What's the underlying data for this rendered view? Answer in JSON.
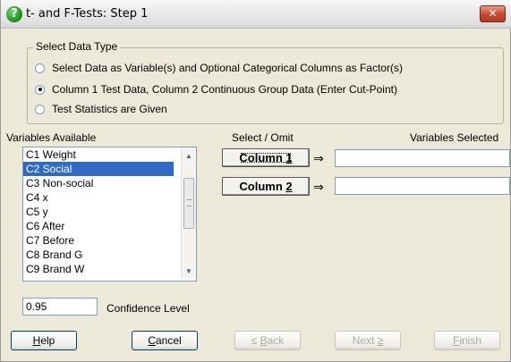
{
  "window": {
    "title": "t- and F-Tests: Step 1",
    "title_icon": "question-icon",
    "close_glyph": "✕"
  },
  "data_type": {
    "legend": "Select Data Type",
    "options": [
      {
        "label": "Select Data as Variable(s) and Optional Categorical Columns as Factor(s)",
        "checked": false
      },
      {
        "label": "Column 1 Test Data, Column 2 Continuous Group Data (Enter Cut-Point)",
        "checked": true
      },
      {
        "label": "Test Statistics are Given",
        "checked": false
      }
    ]
  },
  "variables": {
    "available_label": "Variables Available",
    "select_label": "Select / Omit",
    "selected_label": "Variables Selected",
    "items": [
      "C1 Weight",
      "C2 Social",
      "C3 Non-social",
      "C4 x",
      "C5 y",
      "C6 After",
      "C7 Before",
      "C8 Brand G",
      "C9 Brand W"
    ],
    "selected_item": "C2 Social"
  },
  "columns": {
    "column1_label": "Column 1",
    "column1_value": "",
    "column2_label": "Column 2",
    "column2_value": "",
    "arrow_glyph": "⇒"
  },
  "confidence": {
    "value": "0.95",
    "label": "Confidence Level"
  },
  "footer": {
    "help": "Help",
    "cancel": "Cancel",
    "back": "≤ Back",
    "next": "Next ≥",
    "finish": "Finish"
  },
  "colors": {
    "selection": "#316ac5",
    "dialog_bg": "#ece9d8",
    "close_button": "#c6482c"
  }
}
